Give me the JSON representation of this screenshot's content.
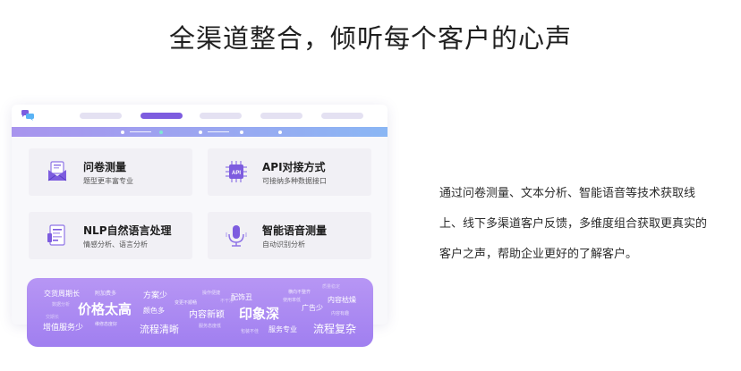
{
  "heading": "全渠道整合，倾听每个客户的心声",
  "cards": [
    {
      "title": "问卷测量",
      "desc": "题型更丰富专业",
      "icon": "envelope-survey-icon"
    },
    {
      "title": "API对接方式",
      "desc": "可接纳多种数据接口",
      "icon": "api-chip-icon",
      "icon_text": "API"
    },
    {
      "title": "NLP自然语言处理",
      "desc": "情感分析、语言分析",
      "icon": "document-analysis-icon"
    },
    {
      "title": "智能语音测量",
      "desc": "自动识别分析",
      "icon": "microphone-icon"
    }
  ],
  "word_cloud": [
    "交货周期长",
    "附加费多",
    "方案少",
    "操作便捷",
    "配饰丑",
    "横向不整齐",
    "内容枯燥",
    "数据分析",
    "价格太高",
    "颜色多",
    "变更不顺畅",
    "内容新颖",
    "印象深",
    "使用率低",
    "广告少",
    "内容有趣",
    "增值服务少",
    "维修态度好",
    "流程清晰",
    "服务态度低",
    "包装不佳",
    "服务专业",
    "流程复杂",
    "交期长",
    "质量稳定",
    "不干净"
  ],
  "description_lines": [
    "通过问卷测量、文本分析、智能语音等技术获取线",
    "上、线下多渠道客户反馈，多维度组合获取更真实的",
    "客户之声，帮助企业更好的了解客户。"
  ],
  "colors": {
    "accent": "#7d5cdf",
    "cloud_top": "#b796f4",
    "cloud_bottom": "#a07ff0",
    "card_bg": "#f1f0f5"
  }
}
